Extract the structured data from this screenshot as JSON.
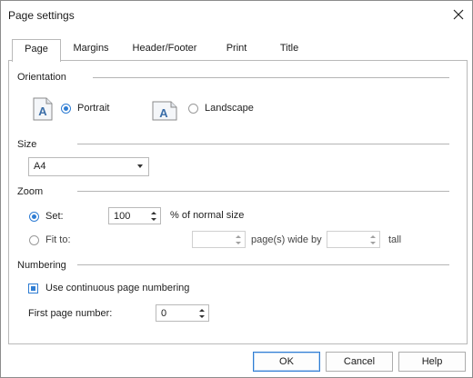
{
  "window": {
    "title": "Page settings"
  },
  "tabs": [
    {
      "label": "Page",
      "active": true
    },
    {
      "label": "Margins"
    },
    {
      "label": "Header/Footer"
    },
    {
      "label": "Print"
    },
    {
      "label": "Title"
    }
  ],
  "orientation": {
    "group_label": "Orientation",
    "icon_letter": "A",
    "portrait_label": "Portrait",
    "landscape_label": "Landscape",
    "selected": "Portrait"
  },
  "size": {
    "group_label": "Size",
    "selected_value": "A4"
  },
  "zoom": {
    "group_label": "Zoom",
    "set_label": "Set:",
    "set_value": "100",
    "set_suffix": "% of normal size",
    "fit_label": "Fit to:",
    "fit_wide_value": "",
    "fit_wide_suffix": "page(s) wide by",
    "fit_tall_value": "",
    "fit_tall_suffix": "tall",
    "selected": "Set"
  },
  "numbering": {
    "group_label": "Numbering",
    "continuous_label": "Use continuous page numbering",
    "continuous_checked": true,
    "first_page_label": "First page number:",
    "first_page_value": "0"
  },
  "buttons": {
    "ok": "OK",
    "cancel": "Cancel",
    "help": "Help"
  },
  "colors": {
    "accent": "#2f7dd3",
    "icon_blue": "#3b6ea8"
  }
}
